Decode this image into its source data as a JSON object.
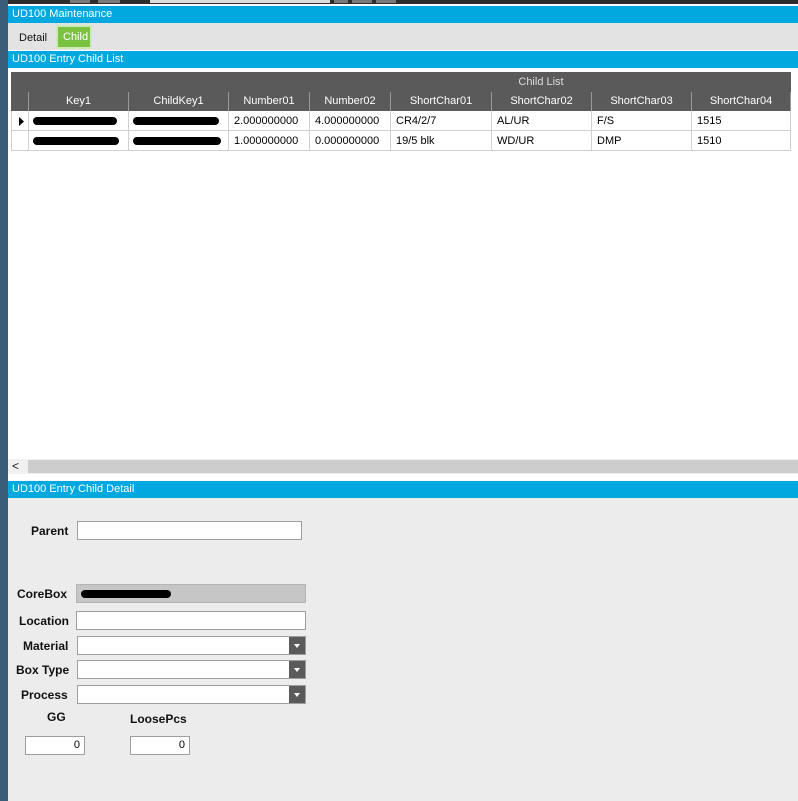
{
  "window": {
    "title": "UD100 Maintenance"
  },
  "tabs": [
    {
      "label": "Detail",
      "active": false
    },
    {
      "label": "Child",
      "active": true
    }
  ],
  "child_list": {
    "section_title": "UD100 Entry Child List",
    "group_header": "Child List",
    "columns": [
      "Key1",
      "ChildKey1",
      "Number01",
      "Number02",
      "ShortChar01",
      "ShortChar02",
      "ShortChar03",
      "ShortChar04"
    ],
    "rows": [
      {
        "Number01": "2.000000000",
        "Number02": "4.000000000",
        "ShortChar01": "CR4/2/7",
        "ShortChar02": "AL/UR",
        "ShortChar03": "F/S",
        "ShortChar04": "1515",
        "selected": true
      },
      {
        "Number01": "1.000000000",
        "Number02": "0.000000000",
        "ShortChar01": "19/5 blk",
        "ShortChar02": "WD/UR",
        "ShortChar03": "DMP",
        "ShortChar04": "1510",
        "selected": false
      }
    ],
    "scroll_left_label": "<"
  },
  "child_detail": {
    "section_title": "UD100 Entry Child Detail",
    "labels": {
      "parent": "Parent",
      "corebox": "CoreBox",
      "location": "Location",
      "material": "Material",
      "box_type": "Box Type",
      "process": "Process",
      "gg": "GG",
      "loose_pcs": "LoosePcs"
    },
    "values": {
      "parent": "",
      "location": "",
      "material": "",
      "box_type": "",
      "process": "",
      "gg": "0",
      "loose_pcs": "0"
    }
  },
  "colors": {
    "header_blue": "#00a8e0",
    "tab_active_green": "#7cc242",
    "grid_header_gray": "#5a5a5a",
    "form_background": "#ececec"
  },
  "icons": [
    "row-selector-arrow-icon",
    "chevron-down-icon",
    "scroll-left-arrow-icon"
  ]
}
